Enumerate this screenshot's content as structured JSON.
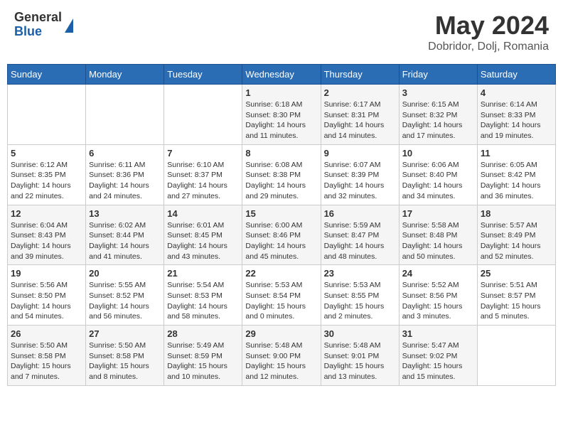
{
  "header": {
    "logo_general": "General",
    "logo_blue": "Blue",
    "month_year": "May 2024",
    "location": "Dobridor, Dolj, Romania"
  },
  "columns": [
    "Sunday",
    "Monday",
    "Tuesday",
    "Wednesday",
    "Thursday",
    "Friday",
    "Saturday"
  ],
  "weeks": [
    [
      {
        "day": "",
        "info": ""
      },
      {
        "day": "",
        "info": ""
      },
      {
        "day": "",
        "info": ""
      },
      {
        "day": "1",
        "info": "Sunrise: 6:18 AM\nSunset: 8:30 PM\nDaylight: 14 hours\nand 11 minutes."
      },
      {
        "day": "2",
        "info": "Sunrise: 6:17 AM\nSunset: 8:31 PM\nDaylight: 14 hours\nand 14 minutes."
      },
      {
        "day": "3",
        "info": "Sunrise: 6:15 AM\nSunset: 8:32 PM\nDaylight: 14 hours\nand 17 minutes."
      },
      {
        "day": "4",
        "info": "Sunrise: 6:14 AM\nSunset: 8:33 PM\nDaylight: 14 hours\nand 19 minutes."
      }
    ],
    [
      {
        "day": "5",
        "info": "Sunrise: 6:12 AM\nSunset: 8:35 PM\nDaylight: 14 hours\nand 22 minutes."
      },
      {
        "day": "6",
        "info": "Sunrise: 6:11 AM\nSunset: 8:36 PM\nDaylight: 14 hours\nand 24 minutes."
      },
      {
        "day": "7",
        "info": "Sunrise: 6:10 AM\nSunset: 8:37 PM\nDaylight: 14 hours\nand 27 minutes."
      },
      {
        "day": "8",
        "info": "Sunrise: 6:08 AM\nSunset: 8:38 PM\nDaylight: 14 hours\nand 29 minutes."
      },
      {
        "day": "9",
        "info": "Sunrise: 6:07 AM\nSunset: 8:39 PM\nDaylight: 14 hours\nand 32 minutes."
      },
      {
        "day": "10",
        "info": "Sunrise: 6:06 AM\nSunset: 8:40 PM\nDaylight: 14 hours\nand 34 minutes."
      },
      {
        "day": "11",
        "info": "Sunrise: 6:05 AM\nSunset: 8:42 PM\nDaylight: 14 hours\nand 36 minutes."
      }
    ],
    [
      {
        "day": "12",
        "info": "Sunrise: 6:04 AM\nSunset: 8:43 PM\nDaylight: 14 hours\nand 39 minutes."
      },
      {
        "day": "13",
        "info": "Sunrise: 6:02 AM\nSunset: 8:44 PM\nDaylight: 14 hours\nand 41 minutes."
      },
      {
        "day": "14",
        "info": "Sunrise: 6:01 AM\nSunset: 8:45 PM\nDaylight: 14 hours\nand 43 minutes."
      },
      {
        "day": "15",
        "info": "Sunrise: 6:00 AM\nSunset: 8:46 PM\nDaylight: 14 hours\nand 45 minutes."
      },
      {
        "day": "16",
        "info": "Sunrise: 5:59 AM\nSunset: 8:47 PM\nDaylight: 14 hours\nand 48 minutes."
      },
      {
        "day": "17",
        "info": "Sunrise: 5:58 AM\nSunset: 8:48 PM\nDaylight: 14 hours\nand 50 minutes."
      },
      {
        "day": "18",
        "info": "Sunrise: 5:57 AM\nSunset: 8:49 PM\nDaylight: 14 hours\nand 52 minutes."
      }
    ],
    [
      {
        "day": "19",
        "info": "Sunrise: 5:56 AM\nSunset: 8:50 PM\nDaylight: 14 hours\nand 54 minutes."
      },
      {
        "day": "20",
        "info": "Sunrise: 5:55 AM\nSunset: 8:52 PM\nDaylight: 14 hours\nand 56 minutes."
      },
      {
        "day": "21",
        "info": "Sunrise: 5:54 AM\nSunset: 8:53 PM\nDaylight: 14 hours\nand 58 minutes."
      },
      {
        "day": "22",
        "info": "Sunrise: 5:53 AM\nSunset: 8:54 PM\nDaylight: 15 hours\nand 0 minutes."
      },
      {
        "day": "23",
        "info": "Sunrise: 5:53 AM\nSunset: 8:55 PM\nDaylight: 15 hours\nand 2 minutes."
      },
      {
        "day": "24",
        "info": "Sunrise: 5:52 AM\nSunset: 8:56 PM\nDaylight: 15 hours\nand 3 minutes."
      },
      {
        "day": "25",
        "info": "Sunrise: 5:51 AM\nSunset: 8:57 PM\nDaylight: 15 hours\nand 5 minutes."
      }
    ],
    [
      {
        "day": "26",
        "info": "Sunrise: 5:50 AM\nSunset: 8:58 PM\nDaylight: 15 hours\nand 7 minutes."
      },
      {
        "day": "27",
        "info": "Sunrise: 5:50 AM\nSunset: 8:58 PM\nDaylight: 15 hours\nand 8 minutes."
      },
      {
        "day": "28",
        "info": "Sunrise: 5:49 AM\nSunset: 8:59 PM\nDaylight: 15 hours\nand 10 minutes."
      },
      {
        "day": "29",
        "info": "Sunrise: 5:48 AM\nSunset: 9:00 PM\nDaylight: 15 hours\nand 12 minutes."
      },
      {
        "day": "30",
        "info": "Sunrise: 5:48 AM\nSunset: 9:01 PM\nDaylight: 15 hours\nand 13 minutes."
      },
      {
        "day": "31",
        "info": "Sunrise: 5:47 AM\nSunset: 9:02 PM\nDaylight: 15 hours\nand 15 minutes."
      },
      {
        "day": "",
        "info": ""
      }
    ]
  ]
}
